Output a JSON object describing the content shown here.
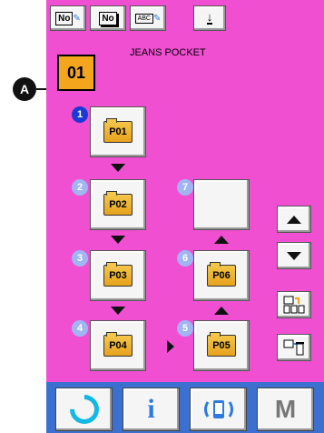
{
  "title": "JEANS POCKET",
  "pattern_no": "01",
  "callout_label": "A",
  "colors": {
    "screen_bg": "#f04fd2",
    "bottom_bar": "#3b6fd0",
    "folder": "#f4c64a",
    "active_num": "#1a3ad4",
    "inactive_num": "#9fb6f2",
    "ok_icon": "#13b8e6",
    "info_icon": "#2c7be0"
  },
  "top_buttons": [
    {
      "name": "no-edit-button",
      "icon": "no-pencil-icon",
      "label": "No."
    },
    {
      "name": "no-copy-button",
      "icon": "no-copy-icon",
      "label": "No."
    },
    {
      "name": "name-edit-button",
      "icon": "abc-pencil-icon",
      "label": "ABC"
    },
    {
      "name": "download-button",
      "icon": "arrow-down-line-icon",
      "label": "↓"
    }
  ],
  "steps": [
    {
      "num": "1",
      "label": "P01",
      "empty": false
    },
    {
      "num": "2",
      "label": "P02",
      "empty": false
    },
    {
      "num": "3",
      "label": "P03",
      "empty": false
    },
    {
      "num": "4",
      "label": "P04",
      "empty": false
    },
    {
      "num": "5",
      "label": "P05",
      "empty": false
    },
    {
      "num": "6",
      "label": "P06",
      "empty": false
    },
    {
      "num": "7",
      "label": "",
      "empty": true
    }
  ],
  "side_buttons": [
    {
      "name": "scroll-up-button",
      "icon": "triangle-up-icon"
    },
    {
      "name": "scroll-down-button",
      "icon": "triangle-down-icon"
    },
    {
      "name": "insert-pattern-button",
      "icon": "insert-grid-icon"
    },
    {
      "name": "delete-pattern-button",
      "icon": "delete-bin-icon"
    }
  ],
  "bottom_buttons": [
    {
      "name": "ready-button",
      "icon": "power-ring-icon"
    },
    {
      "name": "info-button",
      "icon": "info-i-icon",
      "label": "i"
    },
    {
      "name": "communication-button",
      "icon": "communication-icon"
    },
    {
      "name": "mode-button",
      "icon": "mode-m-icon",
      "label": "M"
    }
  ]
}
